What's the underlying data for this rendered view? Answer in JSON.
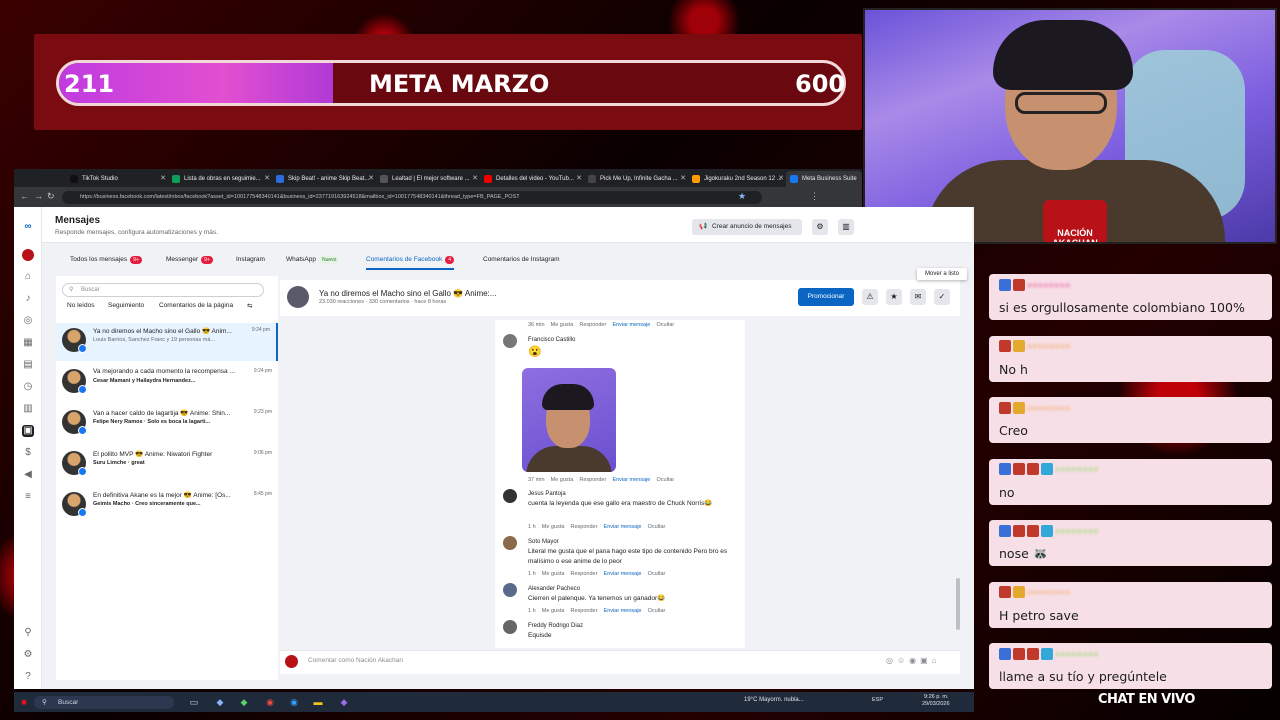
{
  "overlay": {
    "goal": {
      "current": "211",
      "label": "META MARZO",
      "target": "600",
      "progress": 0.35
    },
    "webcam": {
      "logo_text": "NACIÓN AKACHAN"
    },
    "chat": {
      "footer": "CHAT EN VIVO",
      "messages": [
        {
          "text": "si es orgullosamente colombiano 100%",
          "user_color": "#e6478c",
          "badges": [
            "#3b6fd8",
            "#c0392b"
          ]
        },
        {
          "text": "No h",
          "user_color": "#f0a24a",
          "badges": [
            "#c0392b",
            "#e6a92f"
          ]
        },
        {
          "text": "Creo",
          "user_color": "#f0a24a",
          "badges": [
            "#c0392b",
            "#e6a92f"
          ]
        },
        {
          "text": "no",
          "user_color": "#7bd94a",
          "badges": [
            "#3b6fd8",
            "#c0392b",
            "#c0392b",
            "#31a8d8"
          ]
        },
        {
          "text": "nose 🦝",
          "user_color": "#7bd94a",
          "badges": [
            "#3b6fd8",
            "#c0392b",
            "#c0392b",
            "#31a8d8"
          ]
        },
        {
          "text": "H petro save",
          "user_color": "#f0a24a",
          "badges": [
            "#c0392b",
            "#e6a92f"
          ]
        },
        {
          "text": "llame a su tío y pregúntele",
          "user_color": "#7bd94a",
          "badges": [
            "#3b6fd8",
            "#c0392b",
            "#c0392b",
            "#31a8d8"
          ]
        }
      ]
    }
  },
  "browser": {
    "tabs": [
      {
        "label": "TikTok Studio",
        "color": "#111"
      },
      {
        "label": "Lista de obras en seguimie...",
        "color": "#0f9d58"
      },
      {
        "label": "Skip Beat! - anime Skip Beat...",
        "color": "#2d6cdf"
      },
      {
        "label": "Lealtad | El mejor software ...",
        "color": "#555"
      },
      {
        "label": "Detalles del video - YouTub...",
        "color": "#e00"
      },
      {
        "label": "Pick Me Up, Infinite Gacha ...",
        "color": "#444"
      },
      {
        "label": "Jigokuraku 2nd Season 12 ...",
        "color": "#f90"
      },
      {
        "label": "Meta Business Suite",
        "color": "#1877f2"
      }
    ],
    "url": "https://business.facebook.com/latest/inbox/facebook?asset_id=100177548340141&business_id=237719163924518&mailbox_id=100177548340141&thread_type=FB_PAGE_POST"
  },
  "app": {
    "title": "Mensajes",
    "subtitle": "Responde mensajes, configura automatizaciones y más.",
    "create_ad_label": "Crear anuncio de mensajes",
    "tabs": [
      {
        "label": "Todos los mensajes",
        "badge": "9+"
      },
      {
        "label": "Messenger",
        "badge": "9+"
      },
      {
        "label": "Instagram",
        "badge": ""
      },
      {
        "label": "WhatsApp",
        "badge": "Nuevo"
      },
      {
        "label": "Comentarios de Facebook",
        "badge": "4"
      },
      {
        "label": "Comentarios de Instagram",
        "badge": ""
      }
    ],
    "search_placeholder": "Buscar",
    "filters": [
      "No leídos",
      "Seguimiento",
      "Comentarios de la página"
    ],
    "conversations": [
      {
        "title": "Ya no diremos el Macho sino el Gallo 😎 Anim...",
        "preview": "Louis Barrios, Sanchez Franc y 19 personas má...",
        "time": "9:24 pm",
        "bold": false
      },
      {
        "title": "Va mejorando a cada momento la recompensa ...",
        "preview": "Cesar Mamani y Hailaydra Hernandez...",
        "time": "9:24 pm",
        "bold": true
      },
      {
        "title": "Van a hacer caldo de lagartija 😎 Anime: Shin...",
        "preview": "Felipe Nery Ramos · Solo es boca la lagarti...",
        "time": "9:23 pm",
        "bold": true
      },
      {
        "title": "El pollito MVP 😎 Anime: Niwatori Fighter",
        "preview": "Suru Limche · great",
        "time": "9:06 pm",
        "bold": true
      },
      {
        "title": "En definitiva Akane es la mejor 😎 Anime: [Os...",
        "preview": "Geimis Macho · Creo sinceramente que...",
        "time": "8:45 pm",
        "bold": true
      }
    ],
    "thread": {
      "title": "Ya no diremos el Macho sino el Gallo 😎 Anime:...",
      "subtitle": "23.030 reacciones · 330 comentarios · hace 8 horas",
      "promote_label": "Promocionar",
      "tooltip": "Mover a listo",
      "top_meta": [
        "36 min",
        "Me gusta",
        "Responder",
        "Enviar mensaje",
        "Ocultar"
      ],
      "comments": [
        {
          "name": "Francisco Castillo",
          "text": "😮",
          "meta": [
            "37 min",
            "Me gusta",
            "Responder",
            "Enviar mensaje",
            "Ocultar"
          ]
        },
        {
          "name": "Jesus Pantoja",
          "text": "cuenta la leyenda que ese gallo era maestro de Chuck Norris😂",
          "meta": [
            "1 h",
            "Me gusta",
            "Responder",
            "Enviar mensaje",
            "Ocultar"
          ]
        },
        {
          "name": "Soto Mayor",
          "text": "Literal me gusta que el pana hago este tipo de contenido Pero bro es malísimo o ese anime de lo peor",
          "meta": [
            "1 h",
            "Me gusta",
            "Responder",
            "Enviar mensaje",
            "Ocultar"
          ]
        },
        {
          "name": "Alexander Pacheco",
          "text": "Cierren el palenque. Ya tenemos un ganador😂",
          "meta": [
            "1 h",
            "Me gusta",
            "Responder",
            "Enviar mensaje",
            "Ocultar"
          ]
        },
        {
          "name": "Freddy Rodrigo Diaz",
          "text": "Equisde",
          "meta": []
        }
      ],
      "composer_placeholder": "Comentar como Nación Akachan"
    }
  },
  "taskbar": {
    "search": "Buscar",
    "weather": "19°C  Mayorm. nubla...",
    "lang": "ESP",
    "time": "9:26 p. m.",
    "date": "29/03/2026"
  }
}
